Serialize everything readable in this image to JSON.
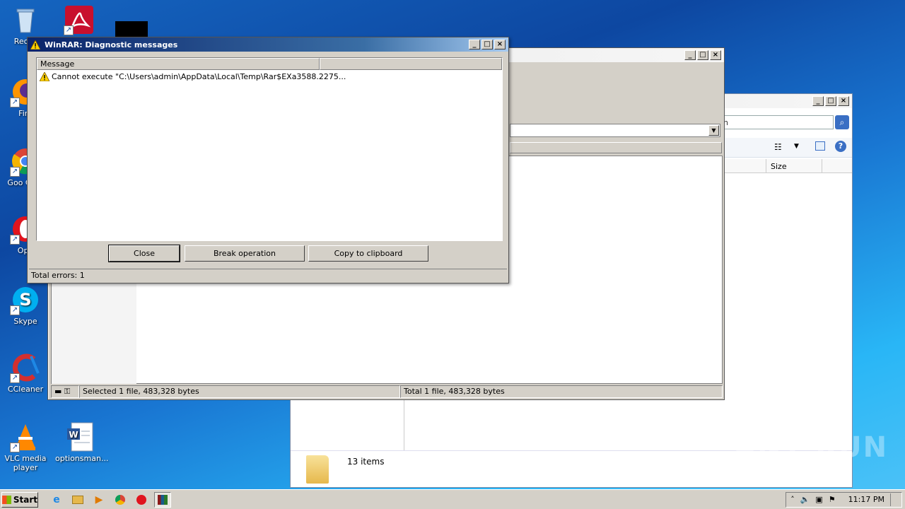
{
  "desktop": {
    "icons": [
      {
        "label": "Recyc"
      },
      {
        "label": "Fire"
      },
      {
        "label": "Goo Chro"
      },
      {
        "label": "Ope"
      },
      {
        "label": "Skype"
      },
      {
        "label": "CCleaner"
      },
      {
        "label": "VLC media player"
      },
      {
        "label": "optionsman..."
      }
    ]
  },
  "explorer": {
    "search_fragment": "h",
    "column_size": "Size",
    "items_count": "13 items"
  },
  "winrar": {
    "status_selected": "Selected 1 file, 483,328 bytes",
    "status_total": "Total 1 file, 483,328 bytes"
  },
  "diag": {
    "title": "WinRAR: Diagnostic messages",
    "column_message": "Message",
    "messages": [
      {
        "text": "Cannot execute \"C:\\Users\\admin\\AppData\\Local\\Temp\\Rar$EXa3588.2275..."
      }
    ],
    "buttons": {
      "close": "Close",
      "break": "Break operation",
      "copy": "Copy to clipboard"
    },
    "status": "Total errors: 1"
  },
  "taskbar": {
    "start_label": "Start",
    "clock": "11:17 PM"
  },
  "watermark": "ANY RUN"
}
